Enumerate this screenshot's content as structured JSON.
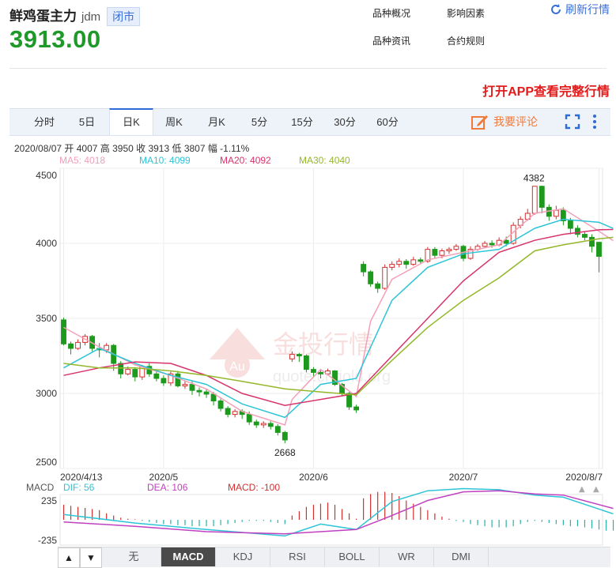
{
  "header": {
    "name": "鲜鸡蛋主力",
    "code": "jdm",
    "status": "闭市",
    "price": "3913.00",
    "links": [
      "品种概况",
      "影响因素",
      "品种资讯",
      "合约规则"
    ],
    "refresh": "刷新行情",
    "promo": "打开APP查看完整行情"
  },
  "tabs": [
    "分时",
    "5日",
    "日K",
    "周K",
    "月K",
    "5分",
    "15分",
    "30分",
    "60分"
  ],
  "active_tab": "日K",
  "comment_label": "我要评论",
  "info": {
    "ohlc": "2020/08/07 开 4007 高 3950 收 3913 低 3807 幅 -1.11%",
    "ma5": "MA5: 4018",
    "ma10": "MA10: 4099",
    "ma20": "MA20: 4092",
    "ma30": "MA30: 4040"
  },
  "watermark": {
    "cn": "金投行情",
    "en": "quote.cngold.org",
    "logo": "Au"
  },
  "macd_legend": {
    "label": "MACD",
    "dif": "DIF: 56",
    "dea": "DEA: 106",
    "macd": "MACD: -100"
  },
  "bottom_tabs": [
    "无",
    "MACD",
    "KDJ",
    "RSI",
    "BOLL",
    "WR",
    "DMI"
  ],
  "bottom_active": "MACD",
  "colors": {
    "up": "#d42f2f",
    "down": "#1d9a1d",
    "ma5": "#f4a0b8",
    "ma10": "#2ec4d8",
    "ma20": "#d8336b",
    "ma30": "#94b82a",
    "price": "#1f9a2a",
    "accent": "#2d6bd6"
  },
  "chart_data": [
    {
      "type": "candlestick",
      "title": "鲜鸡蛋主力 日K",
      "y_ticks": [
        4500,
        4000,
        3500,
        3000,
        2500
      ],
      "ylim": [
        2500,
        4500
      ],
      "x_ticks": [
        "2020/4/13",
        "2020/5",
        "2020/6",
        "2020/7",
        "2020/8/7"
      ],
      "annotations": [
        {
          "label": "4382",
          "value": 4382
        },
        {
          "label": "2668",
          "value": 2668
        }
      ],
      "candles": [
        [
          3490,
          3330,
          3505,
          3320
        ],
        [
          3330,
          3300,
          3345,
          3260
        ],
        [
          3300,
          3340,
          3360,
          3290
        ],
        [
          3340,
          3380,
          3395,
          3320
        ],
        [
          3380,
          3300,
          3390,
          3280
        ],
        [
          3300,
          3290,
          3335,
          3240
        ],
        [
          3290,
          3320,
          3335,
          3270
        ],
        [
          3320,
          3200,
          3330,
          3150
        ],
        [
          3200,
          3130,
          3215,
          3100
        ],
        [
          3130,
          3160,
          3180,
          3120
        ],
        [
          3160,
          3110,
          3175,
          3080
        ],
        [
          3110,
          3180,
          3190,
          3090
        ],
        [
          3180,
          3130,
          3200,
          3110
        ],
        [
          3130,
          3100,
          3155,
          3080
        ],
        [
          3100,
          3070,
          3120,
          3050
        ],
        [
          3070,
          3130,
          3145,
          3050
        ],
        [
          3130,
          3050,
          3150,
          3040
        ],
        [
          3050,
          3060,
          3085,
          3030
        ],
        [
          3060,
          3020,
          3080,
          2990
        ],
        [
          3020,
          3010,
          3040,
          2980
        ],
        [
          3010,
          2995,
          3030,
          2970
        ],
        [
          2995,
          2950,
          3010,
          2920
        ],
        [
          2950,
          2900,
          2965,
          2880
        ],
        [
          2900,
          2860,
          2915,
          2840
        ],
        [
          2860,
          2880,
          2895,
          2840
        ],
        [
          2880,
          2860,
          2895,
          2830
        ],
        [
          2860,
          2810,
          2880,
          2790
        ],
        [
          2810,
          2790,
          2825,
          2770
        ],
        [
          2790,
          2800,
          2815,
          2770
        ],
        [
          2800,
          2780,
          2815,
          2760
        ],
        [
          2780,
          2740,
          2795,
          2720
        ],
        [
          2740,
          2690,
          2750,
          2668
        ],
        [
          3230,
          3260,
          3280,
          3210
        ],
        [
          3260,
          3250,
          3270,
          3210
        ],
        [
          3250,
          3160,
          3260,
          3140
        ],
        [
          3160,
          3140,
          3175,
          3110
        ],
        [
          3140,
          3130,
          3155,
          3100
        ],
        [
          3130,
          3150,
          3165,
          3120
        ],
        [
          3150,
          3060,
          3155,
          3050
        ],
        [
          3060,
          3000,
          3070,
          2980
        ],
        [
          3000,
          2910,
          3010,
          2890
        ],
        [
          2910,
          2890,
          2925,
          2870
        ],
        [
          3860,
          3810,
          3880,
          3780
        ],
        [
          3810,
          3730,
          3820,
          3710
        ],
        [
          3730,
          3700,
          3745,
          3670
        ],
        [
          3700,
          3840,
          3860,
          3690
        ],
        [
          3840,
          3860,
          3880,
          3820
        ],
        [
          3860,
          3880,
          3900,
          3840
        ],
        [
          3880,
          3860,
          3895,
          3830
        ],
        [
          3860,
          3890,
          3910,
          3850
        ],
        [
          3890,
          3880,
          3905,
          3860
        ],
        [
          3880,
          3960,
          3975,
          3870
        ],
        [
          3960,
          3920,
          3975,
          3900
        ],
        [
          3920,
          3950,
          3965,
          3900
        ],
        [
          3950,
          3960,
          3975,
          3930
        ],
        [
          3960,
          3980,
          3995,
          3950
        ],
        [
          3980,
          3900,
          3990,
          3880
        ],
        [
          3900,
          3960,
          3980,
          3890
        ],
        [
          3960,
          3980,
          3995,
          3950
        ],
        [
          3980,
          4000,
          4015,
          3970
        ],
        [
          4000,
          3990,
          4020,
          3970
        ],
        [
          3990,
          4020,
          4040,
          3980
        ],
        [
          4020,
          4000,
          4045,
          3980
        ],
        [
          4000,
          4120,
          4140,
          3990
        ],
        [
          4120,
          4160,
          4180,
          4100
        ],
        [
          4160,
          4200,
          4230,
          4150
        ],
        [
          4200,
          4380,
          4382,
          4190
        ],
        [
          4380,
          4240,
          4385,
          4200
        ],
        [
          4240,
          4180,
          4260,
          4150
        ],
        [
          4180,
          4220,
          4250,
          4160
        ],
        [
          4220,
          4150,
          4240,
          4120
        ],
        [
          4150,
          4100,
          4170,
          4060
        ],
        [
          4100,
          4060,
          4120,
          4040
        ],
        [
          4060,
          4040,
          4080,
          4020
        ],
        [
          4040,
          3980,
          4060,
          3940
        ],
        [
          4007,
          3913,
          3950,
          3807
        ]
      ],
      "ma": {
        "MA5": [
          [
            0,
            3440
          ],
          [
            5,
            3310
          ],
          [
            10,
            3190
          ],
          [
            15,
            3120
          ],
          [
            20,
            3030
          ],
          [
            25,
            2880
          ],
          [
            31,
            2790
          ],
          [
            32,
            2960
          ],
          [
            36,
            3160
          ],
          [
            41,
            2980
          ],
          [
            43,
            3480
          ],
          [
            46,
            3760
          ],
          [
            51,
            3890
          ],
          [
            56,
            3940
          ],
          [
            61,
            3990
          ],
          [
            66,
            4200
          ],
          [
            70,
            4230
          ],
          [
            75,
            4080
          ],
          [
            77,
            4018
          ]
        ],
        "MA10": [
          [
            0,
            3170
          ],
          [
            5,
            3300
          ],
          [
            10,
            3200
          ],
          [
            15,
            3120
          ],
          [
            20,
            3060
          ],
          [
            25,
            2930
          ],
          [
            31,
            2840
          ],
          [
            36,
            3060
          ],
          [
            41,
            3100
          ],
          [
            46,
            3620
          ],
          [
            51,
            3840
          ],
          [
            56,
            3930
          ],
          [
            61,
            3960
          ],
          [
            66,
            4100
          ],
          [
            70,
            4160
          ],
          [
            75,
            4140
          ],
          [
            77,
            4099
          ]
        ],
        "MA20": [
          [
            0,
            3120
          ],
          [
            5,
            3170
          ],
          [
            10,
            3210
          ],
          [
            15,
            3200
          ],
          [
            20,
            3120
          ],
          [
            25,
            3000
          ],
          [
            31,
            2920
          ],
          [
            36,
            2960
          ],
          [
            41,
            3000
          ],
          [
            46,
            3250
          ],
          [
            51,
            3500
          ],
          [
            56,
            3750
          ],
          [
            61,
            3940
          ],
          [
            66,
            4020
          ],
          [
            70,
            4060
          ],
          [
            75,
            4090
          ],
          [
            77,
            4092
          ]
        ],
        "MA30": [
          [
            0,
            3200
          ],
          [
            5,
            3170
          ],
          [
            10,
            3170
          ],
          [
            15,
            3150
          ],
          [
            20,
            3120
          ],
          [
            25,
            3080
          ],
          [
            31,
            3030
          ],
          [
            36,
            3010
          ],
          [
            41,
            2990
          ],
          [
            46,
            3220
          ],
          [
            51,
            3440
          ],
          [
            56,
            3620
          ],
          [
            61,
            3770
          ],
          [
            66,
            3950
          ],
          [
            70,
            3990
          ],
          [
            75,
            4030
          ],
          [
            77,
            4040
          ]
        ]
      }
    },
    {
      "type": "macd",
      "ylim": [
        -235,
        235
      ],
      "y_ticks": [
        235,
        -235
      ],
      "dif": [
        [
          0,
          50
        ],
        [
          10,
          -30
        ],
        [
          20,
          -90
        ],
        [
          31,
          -150
        ],
        [
          36,
          -40
        ],
        [
          41,
          -90
        ],
        [
          46,
          170
        ],
        [
          51,
          270
        ],
        [
          56,
          290
        ],
        [
          61,
          280
        ],
        [
          66,
          230
        ],
        [
          70,
          210
        ],
        [
          77,
          56
        ]
      ],
      "dea": [
        [
          0,
          -20
        ],
        [
          10,
          -60
        ],
        [
          20,
          -110
        ],
        [
          31,
          -130
        ],
        [
          36,
          -110
        ],
        [
          41,
          -90
        ],
        [
          46,
          40
        ],
        [
          51,
          180
        ],
        [
          56,
          260
        ],
        [
          61,
          270
        ],
        [
          66,
          240
        ],
        [
          70,
          230
        ],
        [
          77,
          106
        ]
      ],
      "macd": [
        140,
        130,
        120,
        110,
        100,
        90,
        60,
        40,
        20,
        10,
        5,
        -10,
        -20,
        -30,
        -40,
        -40,
        -50,
        -50,
        -60,
        -60,
        -60,
        -60,
        -50,
        -40,
        -30,
        -20,
        -10,
        -10,
        -10,
        -20,
        -30,
        -40,
        40,
        80,
        120,
        140,
        150,
        160,
        140,
        100,
        60,
        10,
        200,
        240,
        260,
        260,
        250,
        220,
        180,
        150,
        120,
        90,
        60,
        30,
        10,
        -10,
        -20,
        -40,
        -50,
        -60,
        -70,
        -70,
        -70,
        -60,
        -40,
        -20,
        -10,
        -20,
        -30,
        -40,
        -50,
        -60,
        -60,
        -70,
        -80,
        -90,
        -100,
        -100
      ]
    }
  ]
}
